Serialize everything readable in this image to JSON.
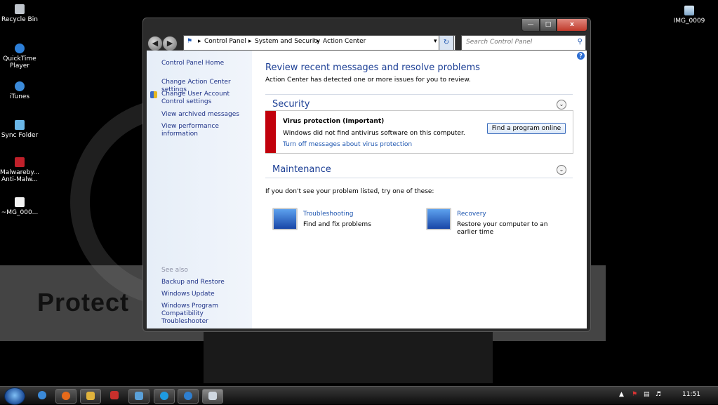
{
  "desktop": {
    "icons": [
      {
        "label": "Recycle Bin",
        "icon": "recycle-bin-icon"
      },
      {
        "label": "QuickTime Player",
        "icon": "quicktime-icon"
      },
      {
        "label": "iTunes",
        "icon": "itunes-icon"
      },
      {
        "label": "Sync Folder",
        "icon": "folder-icon"
      },
      {
        "label": "Malwareby... Anti-Malw...",
        "icon": "malwarebytes-icon"
      },
      {
        "label": "~MG_000...",
        "icon": "file-icon"
      },
      {
        "label": "IMG_0009",
        "icon": "image-file-icon"
      }
    ],
    "watermark": "Protect"
  },
  "window": {
    "title_buttons": {
      "minimize": "—",
      "maximize": "□",
      "close": "x"
    },
    "breadcrumb": [
      "Control Panel",
      "System and Security",
      "Action Center"
    ],
    "search_placeholder": "Search Control Panel"
  },
  "sidebar": {
    "home": "Control Panel Home",
    "links": [
      "Change Action Center settings",
      "Change User Account Control settings",
      "View archived messages",
      "View performance information"
    ],
    "see_also_title": "See also",
    "see_also": [
      "Backup and Restore",
      "Windows Update",
      "Windows Program Compatibility Troubleshooter"
    ]
  },
  "main": {
    "title": "Review recent messages and resolve problems",
    "subtitle": "Action Center has detected one or more issues for you to review.",
    "security": {
      "heading": "Security",
      "alert_title": "Virus protection  (Important)",
      "alert_text": "Windows did not find antivirus software on this computer.",
      "alert_link": "Turn off messages about virus protection",
      "button": "Find a program online",
      "severity_color": "#c1000c"
    },
    "maintenance": {
      "heading": "Maintenance"
    },
    "prompt": "If you don't see your problem listed, try one of these:",
    "tiles": [
      {
        "title": "Troubleshooting",
        "desc": "Find and fix problems",
        "icon": "troubleshooting-icon"
      },
      {
        "title": "Recovery",
        "desc": "Restore your computer to an earlier time",
        "icon": "recovery-icon"
      }
    ]
  },
  "taskbar": {
    "apps": [
      "chrome-icon",
      "firefox-icon",
      "explorer-folder-icon",
      "app-icon",
      "photos-icon",
      "skype-icon",
      "ie-icon",
      "app-window-icon"
    ],
    "clock": "11:51"
  }
}
